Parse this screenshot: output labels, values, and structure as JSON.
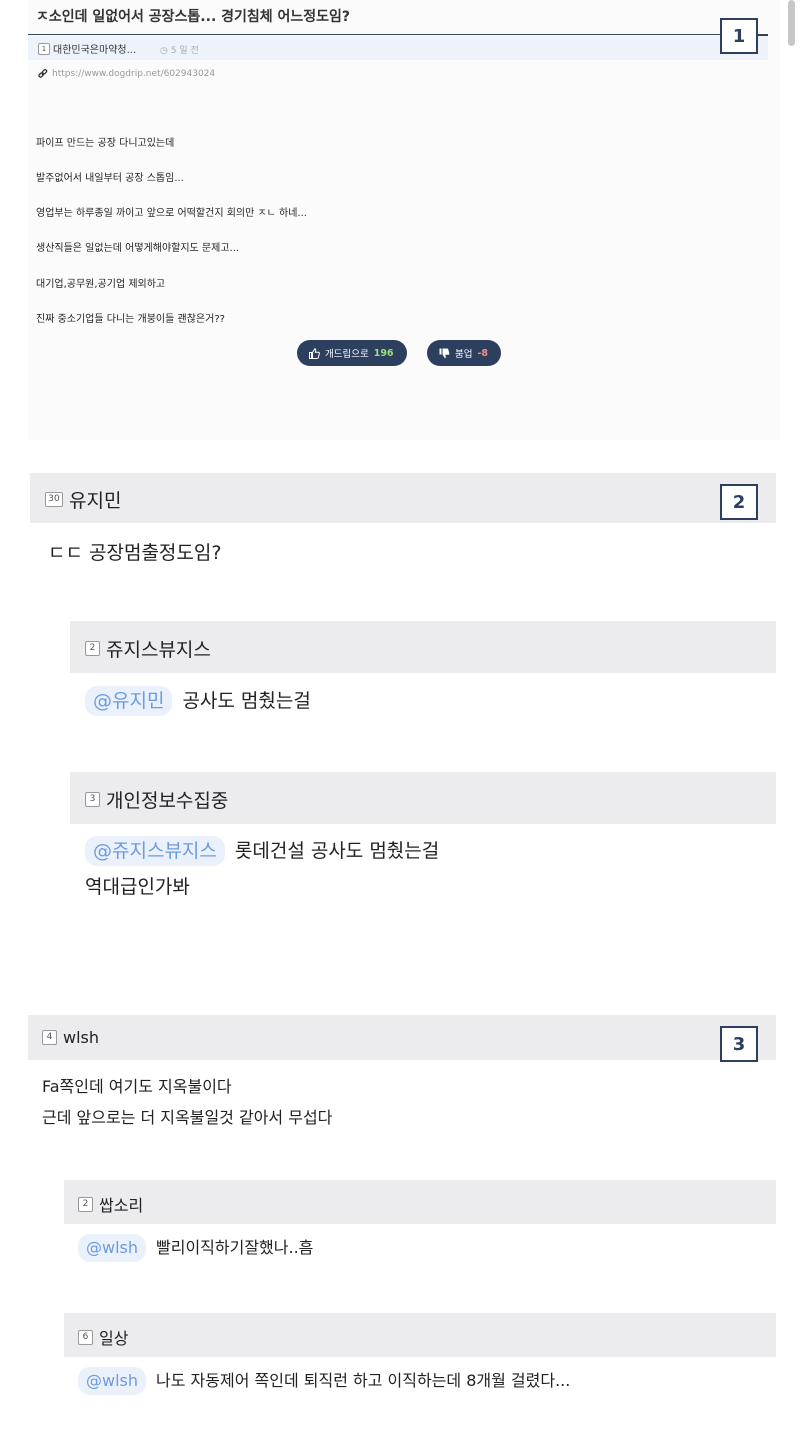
{
  "post": {
    "title": "ㅈ소인데 일없어서 공장스톱... 경기침체 어느정도임?",
    "author_level": "1",
    "author": "대한민국은마약청...",
    "time": "5 일 전",
    "url": "https://www.dogdrip.net/602943024",
    "body": [
      "파이프 만드는 공장 다니고있는데",
      "발주없어서 내일부터 공장 스톱임...",
      "영업부는 하루종일 까이고 앞으로 어떡할건지 회의만 ㅈㄴ 하네...",
      "생산직들은 일없는데 어떻게해야할지도 문제고...",
      "대기업,공무원,공기업 제외하고",
      "진짜 중소기업들 다니는 개붕이들 괜찮은거??"
    ],
    "upvote_label": "개드립으로",
    "upvote_count": "196",
    "downvote_label": "붐업",
    "downvote_count": "-8"
  },
  "annotations": [
    "1",
    "2",
    "3"
  ],
  "comments": [
    {
      "level": "30",
      "author": "유지민",
      "text": "ㄷㄷ 공장멈출정도임?",
      "replies": [
        {
          "level": "2",
          "author": "쥬지스뷰지스",
          "mention": "@유지민",
          "text": "공사도 멈췄는걸",
          "text2": ""
        },
        {
          "level": "3",
          "author": "개인정보수집중",
          "mention": "@쥬지스뷰지스",
          "text": "롯데건설 공사도 멈췄는걸",
          "text2": "역대급인가봐"
        }
      ]
    },
    {
      "level": "4",
      "author": "wlsh",
      "text": "Fa쪽인데 여기도 지옥불이다",
      "text2": "근데 앞으로는 더 지옥불일것 같아서 무섭다",
      "replies": [
        {
          "level": "2",
          "author": "쌉소리",
          "mention": "@wlsh",
          "text": "빨리이직하기잘했나..흠"
        },
        {
          "level": "6",
          "author": "일상",
          "mention": "@wlsh",
          "text": "나도 자동제어 쪽인데 퇴직런 하고 이직하는데 8개월 걸렸다..."
        }
      ]
    }
  ],
  "icons": {
    "level": "level-badge-icon",
    "clock": "clock-icon",
    "link": "link-icon",
    "thumbs_up": "thumbs-up-icon",
    "thumbs_down": "thumbs-down-icon"
  },
  "colors": {
    "accent": "#2d3f5e",
    "mention": "#6c9be0",
    "upvote_count": "#9ce07a",
    "downvote_count": "#ff8a8a"
  }
}
